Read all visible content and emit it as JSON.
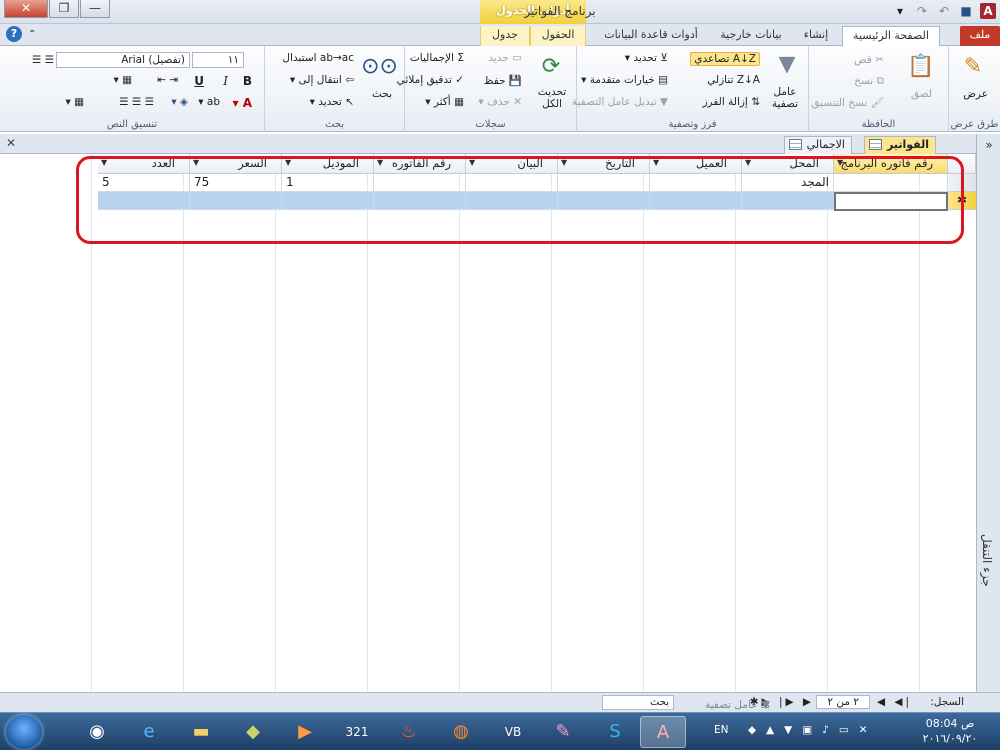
{
  "window": {
    "title": "برنامج الفواتير",
    "context_tab_title": "أدوات الجدول",
    "minimize": "—",
    "restore": "❐",
    "close": "✕"
  },
  "tabs": {
    "file": "ملف",
    "home": "الصفحة الرئيسية",
    "create": "إنشاء",
    "external": "بيانات خارجية",
    "db_tools": "أدوات قاعدة البيانات",
    "fields": "الحقول",
    "table": "جدول"
  },
  "ribbon": {
    "views": {
      "view": "عرض",
      "group": "طرق عرض"
    },
    "clipboard": {
      "paste": "لصق",
      "cut": "قص",
      "copy": "نسخ",
      "format_painter": "نسخ التنسيق",
      "group": "الحافظة"
    },
    "sort_filter": {
      "filter": "عامل تصفية",
      "ascending": "تصاعدي",
      "descending": "تنازلي",
      "remove_sort": "إزالة الفرز",
      "selection": "تحديد",
      "advanced": "خيارات متقدمة",
      "toggle_filter": "تبديل عامل التصفية",
      "group": "فرز وتصفية"
    },
    "records": {
      "refresh_all": "تحديث الكل",
      "new": "جديد",
      "save": "حفظ",
      "delete": "حذف",
      "totals": "الإجماليات",
      "spelling": "تدقيق إملائي",
      "more": "أكثر",
      "group": "سجلات"
    },
    "find": {
      "find": "بحث",
      "replace": "استبدال",
      "goto": "انتقال إلى",
      "select": "تحديد",
      "group": "بحث"
    },
    "text_formatting": {
      "font_name": "(تفصيل) Arial",
      "font_size": "١١",
      "bold": "B",
      "italic": "I",
      "underline": "U",
      "group": "تنسيق النص"
    }
  },
  "nav_pane": {
    "label": "جزء التنقل",
    "toggle": "»"
  },
  "doc_tabs": [
    {
      "label": "الفواتير"
    },
    {
      "label": "الاجمالي"
    }
  ],
  "doc_close": "✕",
  "table": {
    "columns": [
      "رقم فاتوره البرنامج",
      "المحل",
      "العميل",
      "التاريخ",
      "البيان",
      "رقم الفاتوره",
      "الموديل",
      "السعر",
      "العدد"
    ],
    "rows": [
      [
        "",
        "المجد",
        "",
        "",
        "",
        "",
        "1",
        "75",
        "5"
      ]
    ],
    "new_row_marker": "✱"
  },
  "record_nav": {
    "label": "السجل:",
    "position": "٢ من ٢",
    "no_filter": "بلا عامل تصفية",
    "search_placeholder": "بحث"
  },
  "taskbar": {
    "lang": "EN",
    "time": "ص 08:04",
    "date": "٢٠١٦/٠٩/٢٠"
  }
}
